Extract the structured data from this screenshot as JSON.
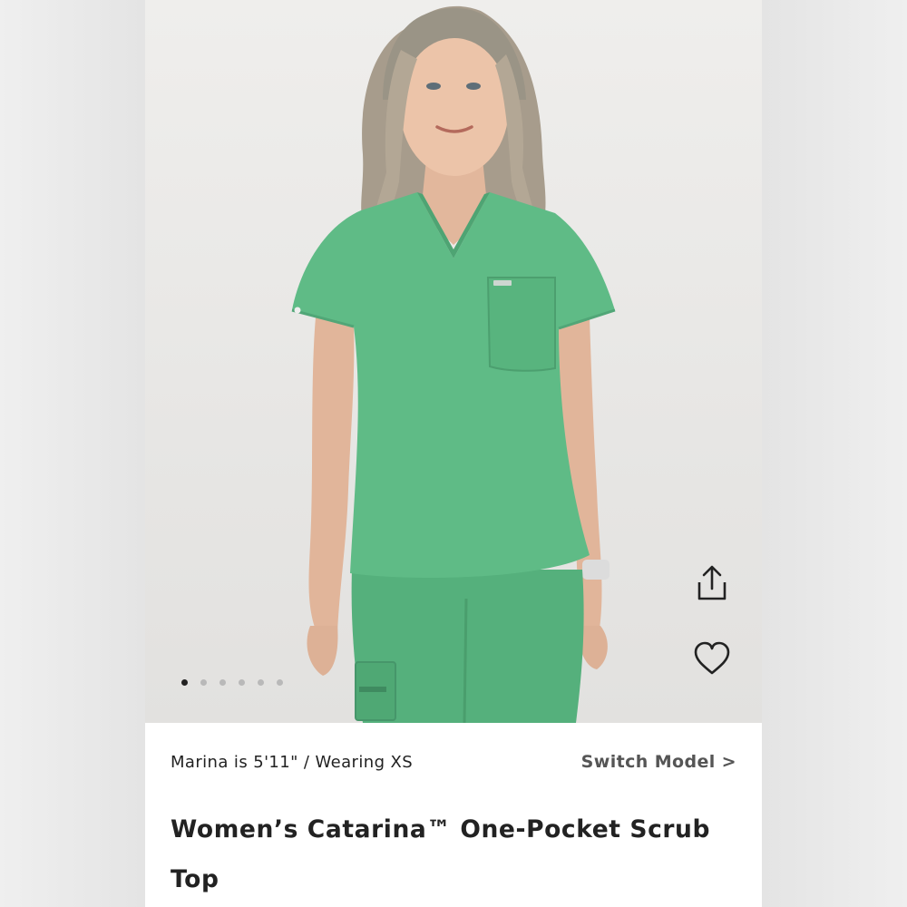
{
  "gallery": {
    "image_alt": "Model wearing green scrub top and pants",
    "dots_count": 6,
    "active_index": 0
  },
  "actions": {
    "share_icon": "share-icon",
    "wishlist_icon": "heart-icon"
  },
  "model": {
    "info": "Marina is 5'11\" / Wearing XS",
    "switch_label": "Switch Model",
    "switch_chevron": ">"
  },
  "product": {
    "title": "Women’s Catarina™ One-Pocket Scrub Top"
  },
  "colors": {
    "scrub": "#5fbb86",
    "text": "#222222",
    "muted": "#555555"
  }
}
